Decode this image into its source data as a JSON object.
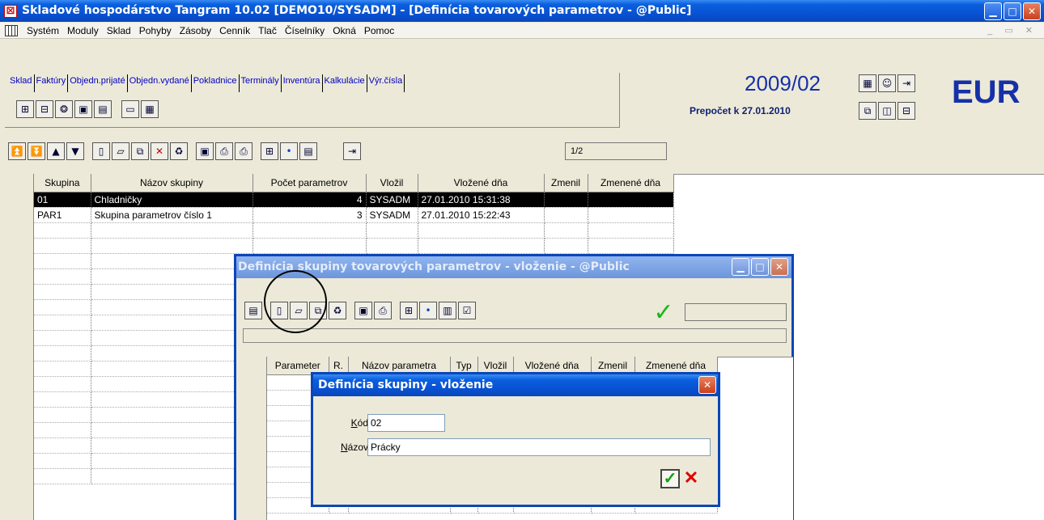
{
  "app": {
    "title": "Skladové hospodárstvo Tangram 10.02 [DEMO10/SYSADM] - [Definícia tovarových parametrov - @Public]"
  },
  "menu": [
    "Systém",
    "Moduly",
    "Sklad",
    "Pohyby",
    "Zásoby",
    "Cenník",
    "Tlač",
    "Číselníky",
    "Okná",
    "Pomoc"
  ],
  "modules": [
    "Sklad",
    "Faktúry",
    "Objedn.prijaté",
    "Objedn.vydané",
    "Pokladnice",
    "Terminály",
    "Inventúra",
    "Kalkulácie",
    "Výr.čísla"
  ],
  "header": {
    "period": "2009/02",
    "prepocet": "Prepočet k 27.01.2010",
    "currency": "EUR"
  },
  "toolbar": {
    "page_info": "1/2"
  },
  "table": {
    "columns": [
      "Skupina",
      "Názov skupiny",
      "Počet parametrov",
      "Vložil",
      "Vložené dňa",
      "Zmenil",
      "Zmenené dňa"
    ],
    "rows": [
      {
        "skupina": "01",
        "nazov": "Chladničky",
        "pocet": "4",
        "vlozil": "SYSADM",
        "vlozene": "27.01.2010 15:31:38",
        "zmenil": "",
        "zmenene": ""
      },
      {
        "skupina": "PAR1",
        "nazov": "Skupina parametrov číslo 1",
        "pocet": "3",
        "vlozil": "SYSADM",
        "vlozene": "27.01.2010 15:22:43",
        "zmenil": "",
        "zmenene": ""
      }
    ]
  },
  "subwindow": {
    "title": "Definícia skupiny tovarových parametrov - vloženie - @Public",
    "columns": [
      "Parameter",
      "R.",
      "Názov parametra",
      "Typ",
      "Vložil",
      "Vložené dňa",
      "Zmenil",
      "Zmenené dňa"
    ]
  },
  "dialog": {
    "title": "Definícia skupiny - vloženie",
    "kod_label_u": "K",
    "kod_label_rest": "ód",
    "kod_value": "02",
    "nazov_label_u": "N",
    "nazov_label_rest": "ázov",
    "nazov_value": "Prácky"
  }
}
